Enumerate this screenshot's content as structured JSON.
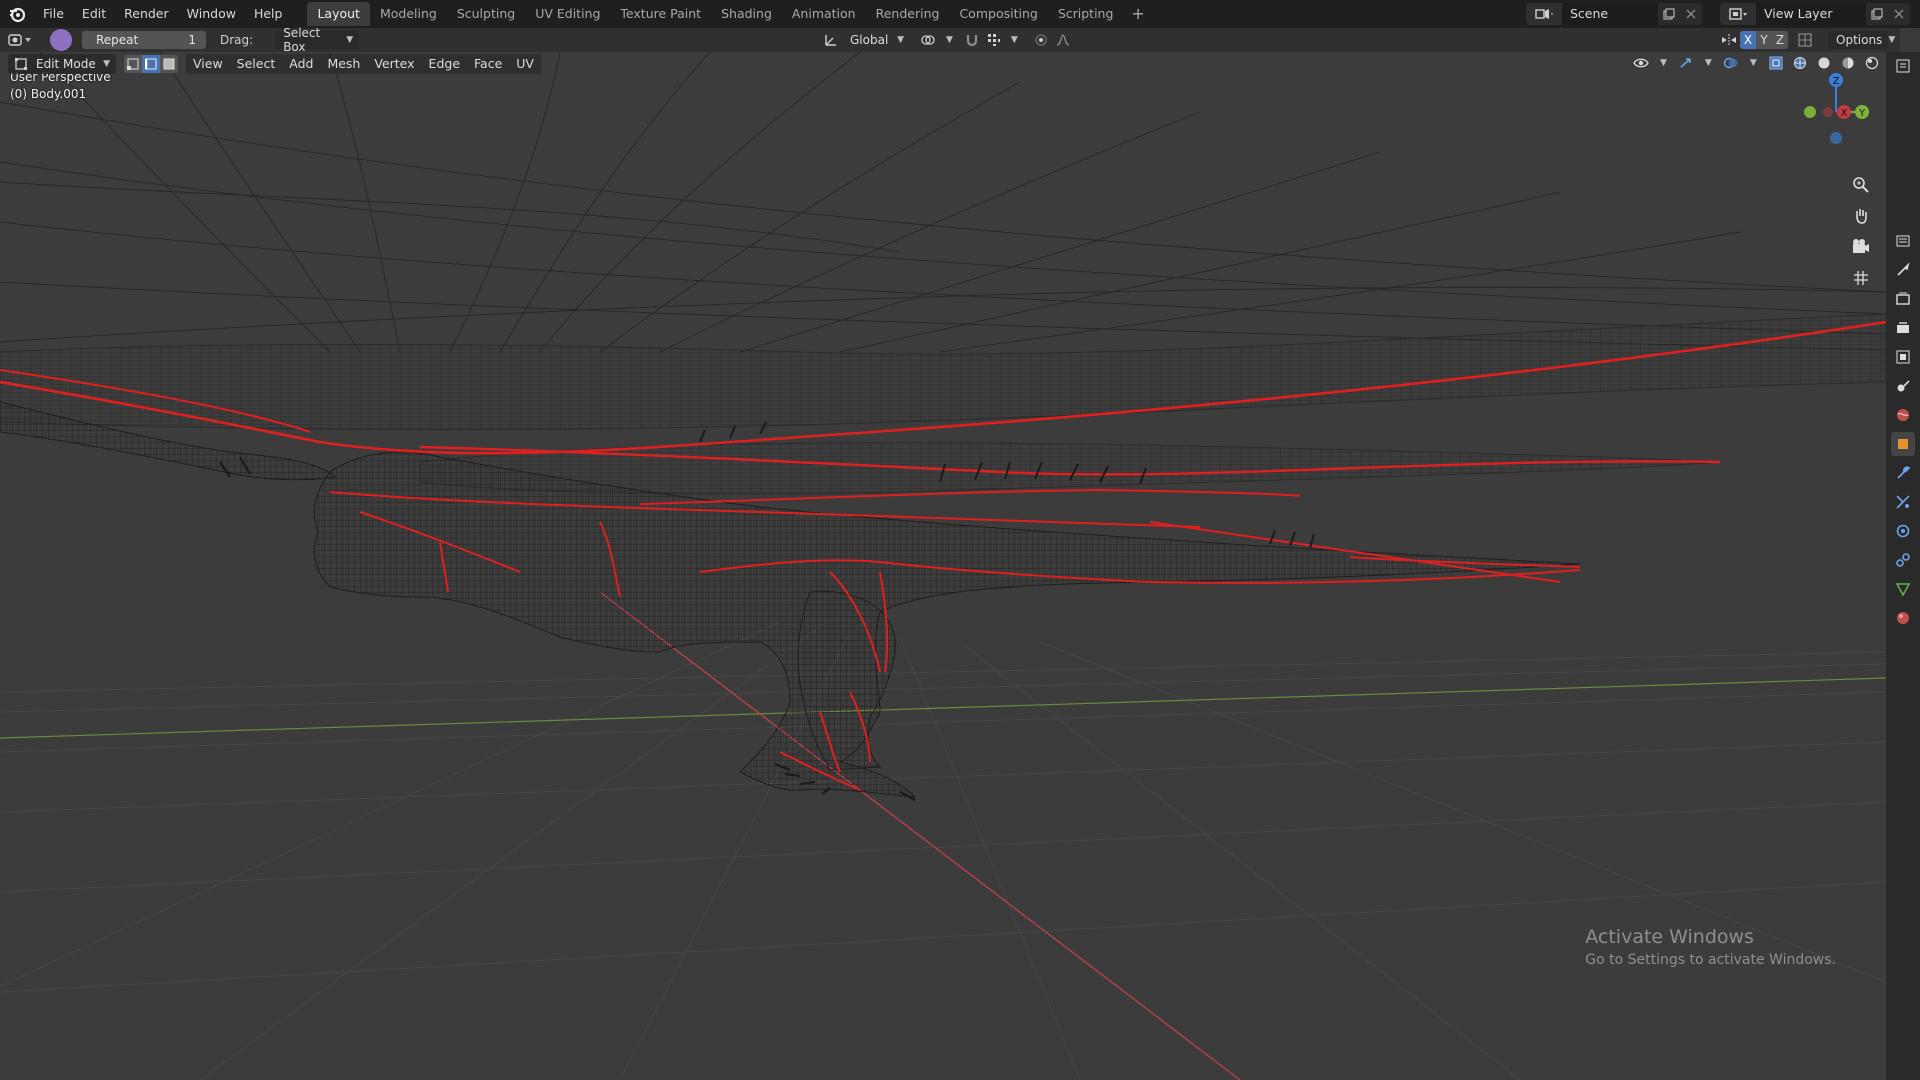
{
  "menus": [
    "File",
    "Edit",
    "Render",
    "Window",
    "Help"
  ],
  "workspaces": [
    "Layout",
    "Modeling",
    "Sculpting",
    "UV Editing",
    "Texture Paint",
    "Shading",
    "Animation",
    "Rendering",
    "Compositing",
    "Scripting"
  ],
  "active_workspace": "Layout",
  "scene": {
    "name": "Scene"
  },
  "view_layer": {
    "name": "View Layer"
  },
  "tool_header": {
    "repeat_label": "Repeat",
    "repeat_count": "1",
    "drag_label": "Drag:",
    "drag_value": "Select Box",
    "transform_orientation": "Global",
    "options_label": "Options"
  },
  "axis_toggles": [
    "X",
    "Y",
    "Z"
  ],
  "view_header": {
    "mode": "Edit Mode",
    "menus": [
      "View",
      "Select",
      "Add",
      "Mesh",
      "Vertex",
      "Edge",
      "Face",
      "UV"
    ]
  },
  "viewport": {
    "perspective_label": "User Perspective",
    "object_label": "(0) Body.001"
  },
  "gizmo_axes": {
    "x": "X",
    "y": "Y",
    "z": "Z"
  },
  "watermark": {
    "title": "Activate Windows",
    "subtitle": "Go to Settings to activate Windows."
  },
  "colors": {
    "accent_blue": "#4772b3",
    "edit_mode_purple": "#8f6fc1",
    "seam_red": "#e02020",
    "axis_x_red": "#c23b45",
    "axis_y_green": "#7fb43a",
    "axis_z_blue": "#3b7fd9"
  },
  "icons": {
    "nav_tools": [
      "zoom-icon",
      "pan-hand-icon",
      "camera-view-icon",
      "ortho-grid-icon"
    ],
    "properties_tabs": [
      "tool-icon",
      "render-icon",
      "output-icon",
      "view-layer-icon",
      "scene-icon",
      "world-icon",
      "object-icon",
      "modifier-icon",
      "particles-icon",
      "physics-icon",
      "constraints-icon",
      "data-icon",
      "material-icon"
    ]
  }
}
